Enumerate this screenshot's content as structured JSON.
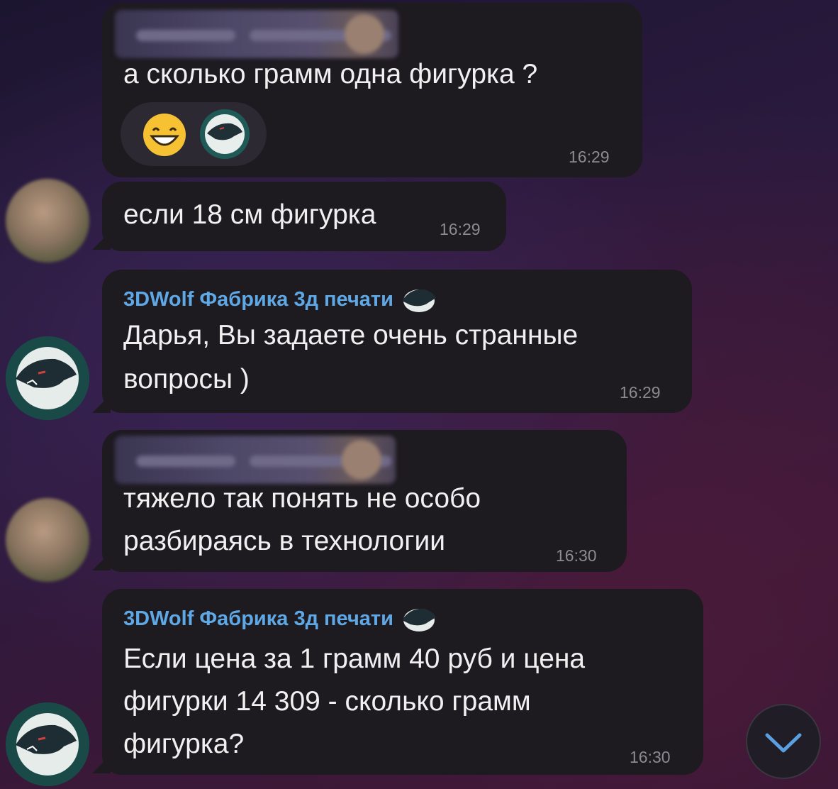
{
  "messages": [
    {
      "sender_name": "",
      "text": "а сколько грамм одна фигурка ?",
      "time": "16:29",
      "reactions": [
        "grinning-face-emoji",
        "wolf-logo-reaction"
      ]
    },
    {
      "text": "если 18 см фигурка",
      "time": "16:29"
    },
    {
      "sender_name": "3DWolf Фабрика 3д печати",
      "text_lines": [
        "Дарья, Вы задаете очень странные",
        "вопросы )"
      ],
      "time": "16:29"
    },
    {
      "sender_name": "",
      "text_lines": [
        "тяжело так понять не особо",
        "разбираясь в технологии"
      ],
      "time": "16:30"
    },
    {
      "sender_name": "3DWolf Фабрика 3д печати",
      "text_lines": [
        "Если цена за 1 грамм 40 руб и цена",
        "фигурки 14 309 - сколько грамм",
        "фигурка?"
      ],
      "time": "16:30"
    }
  ],
  "colors": {
    "bubble": "#1d1a20",
    "sender": "#5fa8e6",
    "time": "#8c8a92",
    "wolf_avatar": "#1a4a48"
  },
  "icons": {
    "scroll_down": "chevron-down-icon"
  }
}
